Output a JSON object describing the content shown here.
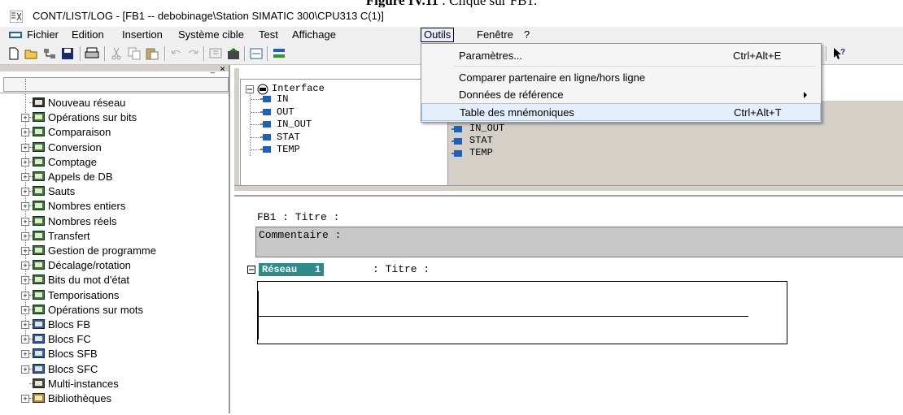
{
  "caption": {
    "bold": "Figure IV.11",
    "rest": " : Clique sur FB1."
  },
  "window": {
    "title": "CONT/LIST/LOG - [FB1 -- debobinage\\Station SIMATIC 300\\CPU313 C(1)]"
  },
  "menu": [
    "Fichier",
    "Edition",
    "Insertion",
    "Système cible",
    "Test",
    "Affichage",
    "Outils",
    "Fenêtre",
    "?"
  ],
  "dropdown": {
    "items": [
      {
        "label": "Paramètres...",
        "shortcut": "Ctrl+Alt+E"
      },
      {
        "label": "Comparer partenaire en ligne/hors ligne",
        "shortcut": ""
      },
      {
        "label": "Données de référence",
        "shortcut": ""
      },
      {
        "label": "Table des mnémoniques",
        "shortcut": "Ctrl+Alt+T"
      }
    ]
  },
  "tree": [
    {
      "label": "Nouveau réseau",
      "icon": "new-network-icon"
    },
    {
      "label": "Opérations sur bits",
      "icon": "bit-logic-icon"
    },
    {
      "label": "Comparaison",
      "icon": "compare-icon"
    },
    {
      "label": "Conversion",
      "icon": "convert-icon"
    },
    {
      "label": "Comptage",
      "icon": "counter-icon"
    },
    {
      "label": "Appels de DB",
      "icon": "db-call-icon"
    },
    {
      "label": "Sauts",
      "icon": "jump-icon"
    },
    {
      "label": "Nombres entiers",
      "icon": "integer-icon"
    },
    {
      "label": "Nombres réels",
      "icon": "real-number-icon"
    },
    {
      "label": "Transfert",
      "icon": "move-icon"
    },
    {
      "label": "Gestion de programme",
      "icon": "program-control-icon"
    },
    {
      "label": "Décalage/rotation",
      "icon": "shift-rotate-icon"
    },
    {
      "label": "Bits du mot d'état",
      "icon": "status-word-icon"
    },
    {
      "label": "Temporisations",
      "icon": "timer-icon"
    },
    {
      "label": "Opérations sur mots",
      "icon": "word-logic-icon"
    },
    {
      "label": "Blocs FB",
      "icon": "fb-block-icon"
    },
    {
      "label": "Blocs FC",
      "icon": "fc-block-icon"
    },
    {
      "label": "Blocs SFB",
      "icon": "sfb-block-icon"
    },
    {
      "label": "Blocs SFC",
      "icon": "sfc-block-icon"
    },
    {
      "label": "Multi-instances",
      "icon": "multi-instance-icon"
    },
    {
      "label": "Bibliothèques",
      "icon": "library-icon"
    }
  ],
  "interface": {
    "root": "Interface",
    "items": [
      "IN",
      "OUT",
      "IN_OUT",
      "STAT",
      "TEMP"
    ],
    "right_items": [
      "IN_OUT",
      "STAT",
      "TEMP"
    ]
  },
  "editor": {
    "block_title": "FB1 : Titre :",
    "comment": "Commentaire :",
    "network_label": "Réseau",
    "network_number": "1",
    "network_title": ": Titre :"
  },
  "colors": {
    "network_label_bg": "#2e8b8b",
    "comment_bg": "#c8c8c8",
    "menu_highlight": "#e5eefb"
  }
}
